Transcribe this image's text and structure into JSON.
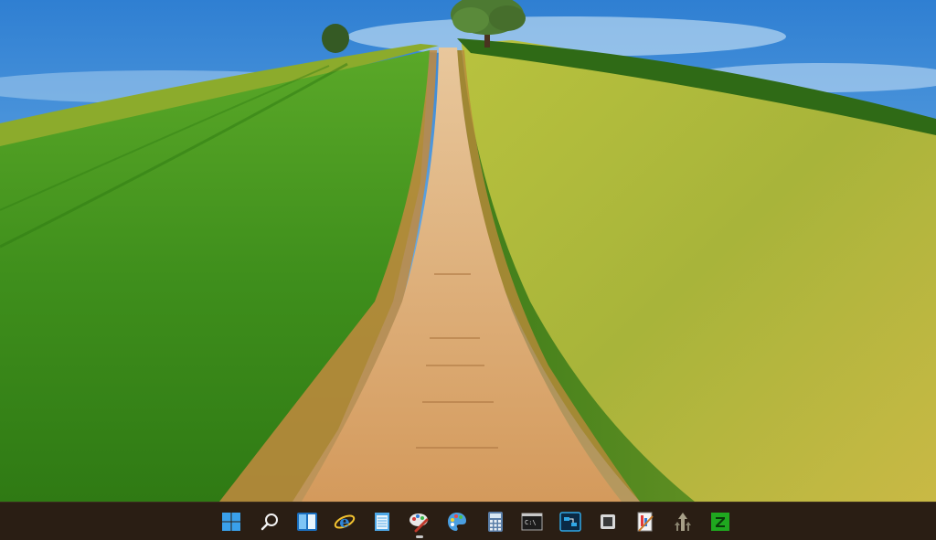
{
  "desktop": {
    "wallpaper": "dirt-road-through-green-fields-with-tree-on-hill",
    "sky_color": "#3f8fd8",
    "grass_color": "#4c9a1f",
    "field_color": "#a9b83a",
    "road_color": "#d9a870"
  },
  "taskbar": {
    "background": "#2a1e14",
    "items": [
      {
        "icon": "windows-start-icon",
        "active": false
      },
      {
        "icon": "search-icon",
        "active": false
      },
      {
        "icon": "widgets-icon",
        "active": false
      },
      {
        "icon": "internet-explorer-icon",
        "active": false
      },
      {
        "icon": "notepad-icon",
        "active": false
      },
      {
        "icon": "paint-brush-icon",
        "active": true
      },
      {
        "icon": "paint-palette-icon",
        "active": false
      },
      {
        "icon": "calculator-icon",
        "active": false
      },
      {
        "icon": "command-prompt-icon",
        "active": false
      },
      {
        "icon": "remote-desktop-icon",
        "active": false
      },
      {
        "icon": "app-window-icon",
        "active": false
      },
      {
        "icon": "resource-editor-icon",
        "active": false
      },
      {
        "icon": "arrows-tool-icon",
        "active": false
      },
      {
        "icon": "z-app-icon",
        "active": false
      }
    ]
  }
}
